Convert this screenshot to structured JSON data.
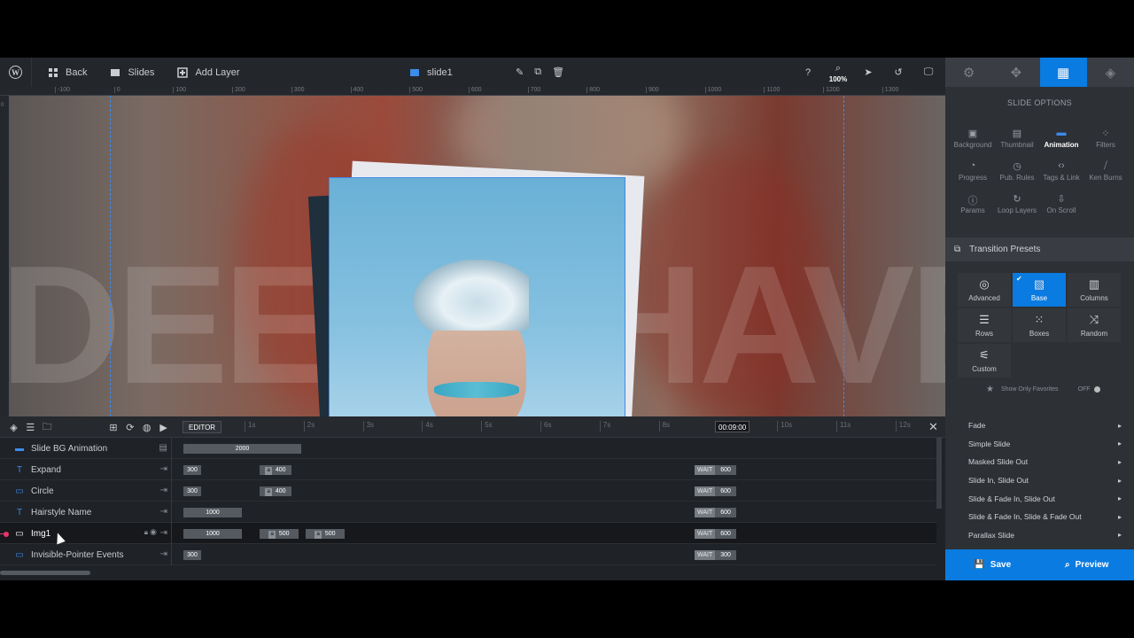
{
  "topbar": {
    "back_label": "Back",
    "slides_label": "Slides",
    "add_layer_label": "Add Layer",
    "slide_name": "slide1",
    "zoom": "100%"
  },
  "ruler": {
    "labels": [
      "-100",
      "0",
      "100",
      "200",
      "300",
      "400",
      "500",
      "600",
      "700",
      "800",
      "900",
      "1000",
      "1100",
      "1200",
      "1300"
    ]
  },
  "side_tabs": {
    "active": "slide-options"
  },
  "panel": {
    "title": "SLIDE OPTIONS",
    "options": [
      {
        "label": "Background",
        "icon": "▣"
      },
      {
        "label": "Thumbnail",
        "icon": "▤"
      },
      {
        "label": "Animation",
        "icon": "▬"
      },
      {
        "label": "Filters",
        "icon": "⁘"
      },
      {
        "label": "Progress",
        "icon": "◔"
      },
      {
        "label": "Pub. Rules",
        "icon": "◷"
      },
      {
        "label": "Tags & Link",
        "icon": "‹›"
      },
      {
        "label": "Ken Burns",
        "icon": "⧸"
      },
      {
        "label": "Params",
        "icon": "ⓘ"
      },
      {
        "label": "Loop Layers",
        "icon": "↻"
      },
      {
        "label": "On Scroll",
        "icon": "⇩"
      }
    ],
    "active_option": "Animation",
    "presets_title": "Transition Presets",
    "preset_buttons": [
      {
        "label": "Advanced",
        "icon": "◎"
      },
      {
        "label": "Base",
        "icon": "▧"
      },
      {
        "label": "Columns",
        "icon": "▥"
      },
      {
        "label": "Rows",
        "icon": "☰"
      },
      {
        "label": "Boxes",
        "icon": "⁙"
      },
      {
        "label": "Random",
        "icon": "⤨"
      },
      {
        "label": "Custom",
        "icon": "⚟"
      }
    ],
    "active_preset": "Base",
    "favorites_label": "Show Only Favorites",
    "favorites_toggle": "OFF",
    "preset_list": [
      "Fade",
      "Simple Slide",
      "Masked Slide Out",
      "Slide In, Slide Out",
      "Slide & Fade In, Slide Out",
      "Slide & Fade In, Slide & Fade Out",
      "Parallax Slide"
    ],
    "save_label": "Save",
    "preview_label": "Preview"
  },
  "timeline": {
    "editor_label": "EDITOR",
    "seconds": [
      "1s",
      "2s",
      "3s",
      "4s",
      "5s",
      "6s",
      "7s",
      "8s",
      "9s",
      "10s",
      "11s",
      "12s"
    ],
    "current_time": "00:09:00",
    "wait_label": "WAIT",
    "rows": [
      {
        "name": "Slide BG Animation",
        "icon": "▬",
        "bars": [
          {
            "label": "2000"
          }
        ],
        "wait": null
      },
      {
        "name": "Expand",
        "icon": "T",
        "bars": [
          {
            "label": "300"
          },
          {
            "label": "400"
          }
        ],
        "wait": "600"
      },
      {
        "name": "Circle",
        "icon": "▭",
        "bars": [
          {
            "label": "300"
          },
          {
            "label": "400"
          }
        ],
        "wait": "600"
      },
      {
        "name": "Hairstyle Name",
        "icon": "T",
        "bars": [
          {
            "label": "1000"
          }
        ],
        "wait": "600"
      },
      {
        "name": "Img1",
        "icon": "▭",
        "bars": [
          {
            "label": "1000"
          },
          {
            "label": "500"
          },
          {
            "label": "500"
          }
        ],
        "wait": "600"
      },
      {
        "name": "Invisible-Pointer Events",
        "icon": "▭",
        "bars": [
          {
            "label": "300"
          }
        ],
        "wait": "300"
      }
    ]
  }
}
